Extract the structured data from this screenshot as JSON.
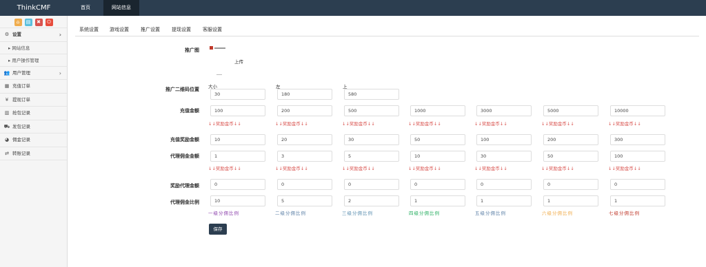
{
  "app": {
    "brand": "ThinkCMF"
  },
  "topnav": [
    "首页",
    "网站信息"
  ],
  "sidebar": {
    "quick_colors": [
      "#f0ad4e",
      "#5bc0de",
      "#d9534f",
      "#e74c3c"
    ],
    "items": [
      {
        "label": "设置",
        "icon": "gears-icon"
      },
      {
        "label": "网站信息"
      },
      {
        "label": "用户操作管理"
      },
      {
        "label": "用户管理",
        "icon": "users-icon"
      },
      {
        "label": "充值订单",
        "icon": "bar-chart-icon"
      },
      {
        "label": "提现订单",
        "icon": "yen-icon"
      },
      {
        "label": "抢包记录",
        "icon": "bar-chart-icon"
      },
      {
        "label": "发包记录",
        "icon": "truck-icon"
      },
      {
        "label": "佣金记录",
        "icon": "pie-chart-icon"
      },
      {
        "label": "转账记录",
        "icon": "swap-icon"
      }
    ]
  },
  "tabs": [
    "系统设置",
    "游戏设置",
    "推广设置",
    "提现设置",
    "客服设置"
  ],
  "form": {
    "promo_image_label": "推广图",
    "upload_label": "上传",
    "qr_position_label": "推广二维码位置",
    "qr_fields": [
      {
        "caption": "大小",
        "value": "30"
      },
      {
        "caption": "左",
        "value": "180"
      },
      {
        "caption": "上",
        "value": "580"
      }
    ],
    "recharge_label": "充值金额",
    "recharge_values": [
      "100",
      "200",
      "500",
      "1000",
      "3000",
      "5000",
      "10000"
    ],
    "reward_tip": "↓↓奖励金币↓↓",
    "recharge_reward_label": "充值奖励金额",
    "recharge_reward_values": [
      "10",
      "20",
      "30",
      "50",
      "100",
      "200",
      "300"
    ],
    "agent_commission_label": "代理佣金金额",
    "agent_commission_values": [
      "1",
      "3",
      "5",
      "10",
      "30",
      "50",
      "100"
    ],
    "agent_reward_label": "奖励代理金额",
    "agent_reward_values": [
      "0",
      "0",
      "0",
      "0",
      "0",
      "0",
      "0"
    ],
    "agent_ratio_label": "代理佣金比例",
    "agent_ratio_values": [
      "10",
      "5",
      "2",
      "1",
      "1",
      "1",
      "1"
    ],
    "ratio_captions": [
      {
        "text": "一级分佣比例",
        "color": "#8e44ad"
      },
      {
        "text": "二级分佣比例",
        "color": "#5b7fa6"
      },
      {
        "text": "三级分佣比例",
        "color": "#5b8fb0"
      },
      {
        "text": "四级分佣比例",
        "color": "#27ae60"
      },
      {
        "text": "五级分佣比例",
        "color": "#5b7fa6"
      },
      {
        "text": "六级分佣比例",
        "color": "#f0ad4e"
      },
      {
        "text": "七级分佣比例",
        "color": "#c0392b"
      }
    ],
    "save_label": "保存"
  }
}
